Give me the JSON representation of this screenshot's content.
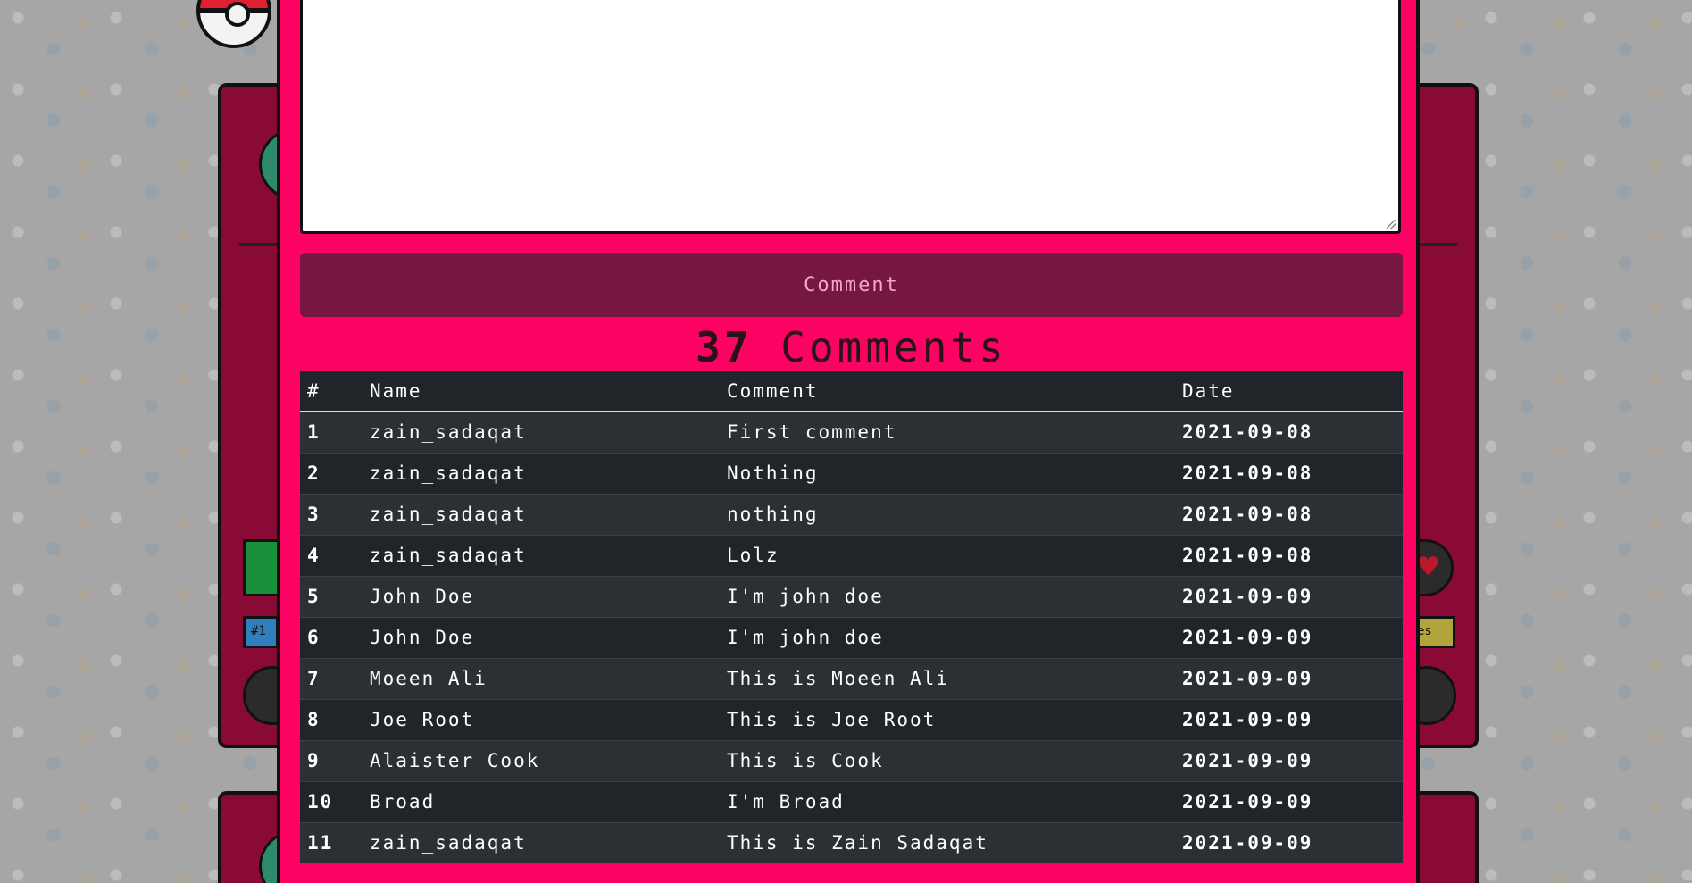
{
  "modal": {
    "comment_button_label": "Comment",
    "comment_count": "37",
    "comment_count_suffix": "Comments"
  },
  "table": {
    "headers": [
      "#",
      "Name",
      "Comment",
      "Date"
    ],
    "rows": [
      {
        "index": "1",
        "name": "zain_sadaqat",
        "comment": "First comment",
        "date": "2021-09-08"
      },
      {
        "index": "2",
        "name": "zain_sadaqat",
        "comment": "Nothing",
        "date": "2021-09-08"
      },
      {
        "index": "3",
        "name": "zain_sadaqat",
        "comment": "nothing",
        "date": "2021-09-08"
      },
      {
        "index": "4",
        "name": "zain_sadaqat",
        "comment": "Lolz",
        "date": "2021-09-08"
      },
      {
        "index": "5",
        "name": "John Doe",
        "comment": "I'm john doe",
        "date": "2021-09-09"
      },
      {
        "index": "6",
        "name": "John Doe",
        "comment": "I'm john doe",
        "date": "2021-09-09"
      },
      {
        "index": "7",
        "name": "Moeen Ali",
        "comment": "This is Moeen Ali",
        "date": "2021-09-09"
      },
      {
        "index": "8",
        "name": "Joe Root",
        "comment": "This is Joe Root",
        "date": "2021-09-09"
      },
      {
        "index": "9",
        "name": "Alaister Cook",
        "comment": "This is Cook",
        "date": "2021-09-09"
      },
      {
        "index": "10",
        "name": "Broad",
        "comment": "I'm Broad",
        "date": "2021-09-09"
      },
      {
        "index": "11",
        "name": "zain_sadaqat",
        "comment": "This is Zain Sadaqat",
        "date": "2021-09-09"
      }
    ]
  },
  "background": {
    "peek_blue_text": "#1",
    "peek_olive_text": "es"
  },
  "colors": {
    "modal_bg": "#fc0263",
    "button_bg": "#751741",
    "table_bg": "#212529",
    "card_bg": "#8a0a36"
  }
}
